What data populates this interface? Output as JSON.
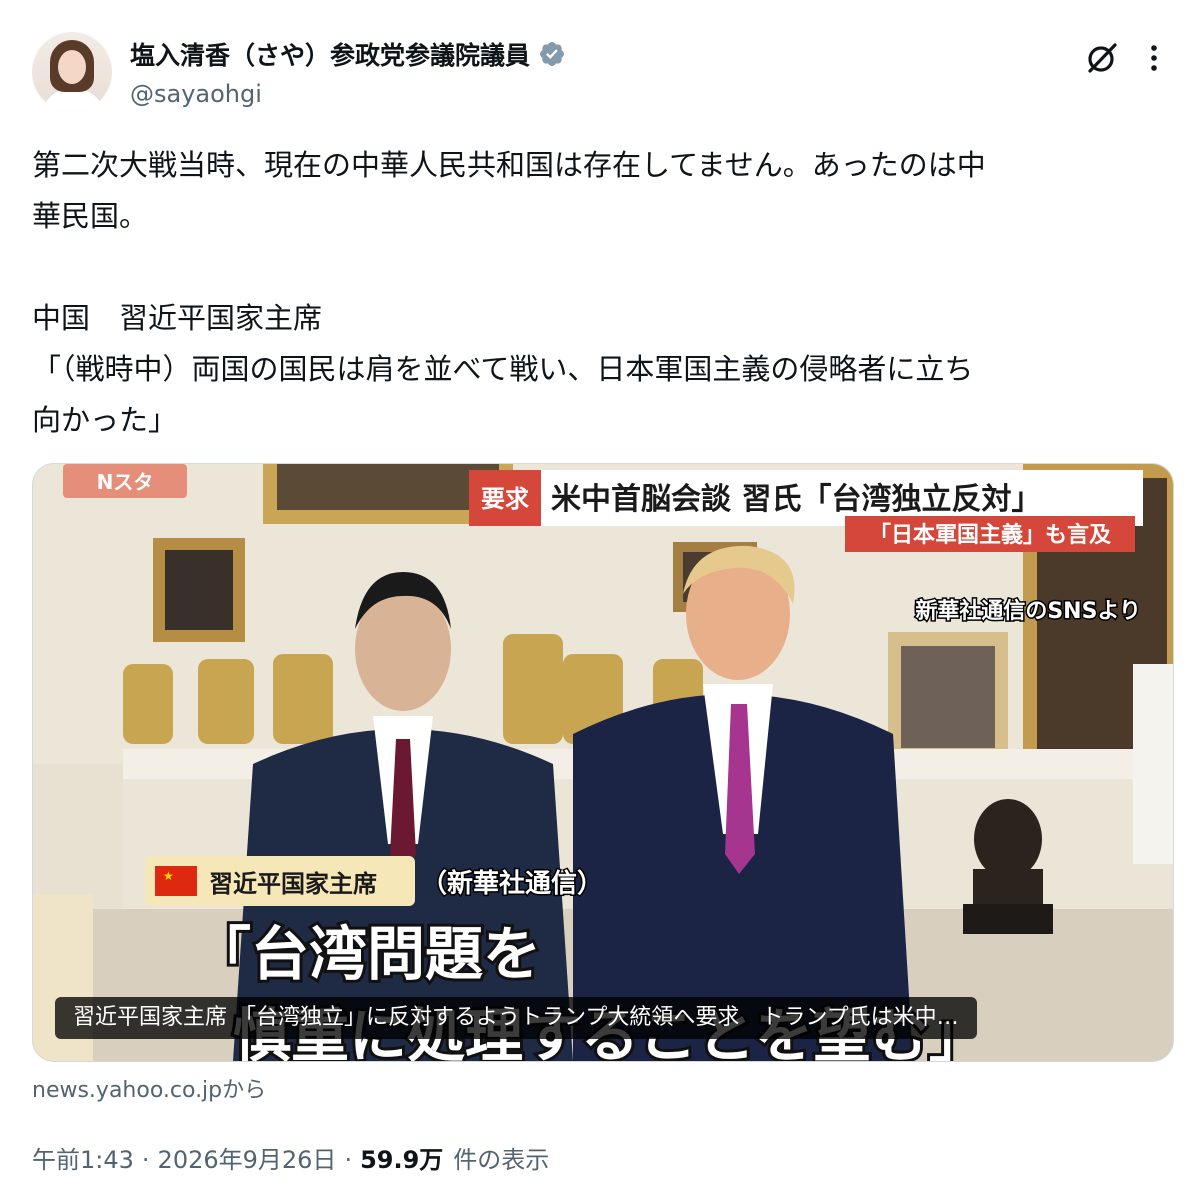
{
  "author": {
    "display_name": "塩入清香（さや）参政党参議院議員",
    "handle": "@sayaohgi",
    "verified": true
  },
  "icons": {
    "verified": "verified-badge-icon",
    "grok": "grok-icon",
    "more": "more-icon"
  },
  "tweet": {
    "text": "第二次大戦当時、現在の中華人民共和国は存在してません。あったのは中\n華民国。\n\n中国　習近平国家主席\n「（戦時中）両国の国民は肩を並べて戦い、日本軍国主義の侵略者に立ち\n向かった」"
  },
  "card": {
    "program_logo": "Nスタ",
    "headline_tag": "要求",
    "headline": "米中首脳会談 習氏「台湾独立反対」",
    "subheadline": "「日本軍国主義」も言及",
    "source_note": "新華社通信のSNSより",
    "speaker_label": "習近平国家主席",
    "speaker_source": "（新華社通信）",
    "quote_line1": "「台湾問題を",
    "quote_line2": "慎重に処理することを望む」",
    "caption": "習近平国家主席 「台湾独立」に反対するようトランプ大統領へ要求　トランプ氏は米中…",
    "source_domain": "news.yahoo.co.jpから"
  },
  "meta": {
    "time": "午前1:43",
    "date": "2026年9月26日",
    "views_count": "59.9万",
    "views_label": "件の表示",
    "separator": "·"
  },
  "colors": {
    "accent": "#1d9bf0",
    "verified_badge": "#829aab",
    "banner_red": "#d5473a",
    "text_secondary": "#536471"
  }
}
